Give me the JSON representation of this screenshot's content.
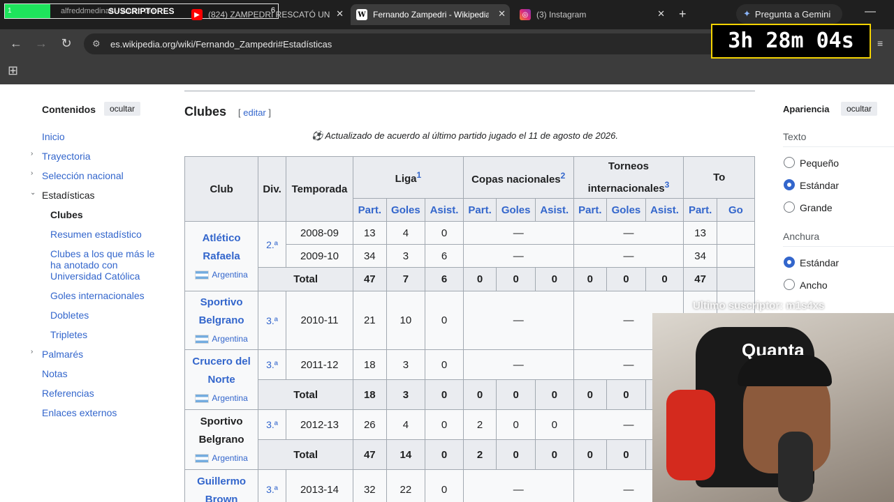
{
  "tabs": [
    {
      "title": "alfreddmedinaa - Watch the",
      "favicon": "stream"
    },
    {
      "title": "(824) ZAMPEDRI RESCATÓ UN",
      "favicon": "youtube"
    },
    {
      "title": "Fernando Zampedri - Wikipedia",
      "favicon": "wikipedia"
    },
    {
      "title": "(3) Instagram",
      "favicon": "instagram"
    }
  ],
  "subs_overlay": {
    "label": "SUSCRIPTORES",
    "left_num": "1",
    "right_num": "6"
  },
  "gemini_label": "Pregunta a Gemini",
  "url": "es.wikipedia.org/wiki/Fernando_Zampedri#Estadísticas",
  "timer": "3h 28m 04s",
  "toc": {
    "title": "Contenidos",
    "hide": "ocultar",
    "items": [
      "Inicio",
      "Trayectoria",
      "Selección nacional",
      "Estadísticas",
      "Clubes",
      "Resumen estadístico",
      "Clubes a los que más le ha anotado con Universidad Católica",
      "Goles internacionales",
      "Dobletes",
      "Tripletes",
      "Palmarés",
      "Notas",
      "Referencias",
      "Enlaces externos"
    ]
  },
  "section": {
    "title": "Clubes",
    "edit": "editar",
    "note": "Actualizado de acuerdo al último partido jugado el 11 de agosto de 2026."
  },
  "table": {
    "headers": {
      "club": "Club",
      "div": "Div.",
      "season": "Temporada",
      "liga": "Liga",
      "liga_sup": "1",
      "copas": "Copas nacionales",
      "copas_sup": "2",
      "torneos": "Torneos internacionales",
      "torneos_sup": "3",
      "total": "To"
    },
    "sub": {
      "part": "Part.",
      "goles": "Goles",
      "asist": "Asist.",
      "go": "Go"
    },
    "country": "Argentina",
    "total_label": "Total",
    "dash": "—",
    "clubs": [
      {
        "name": "Atlético Rafaela",
        "div": "2.ª"
      },
      {
        "name": "Sportivo Belgrano",
        "div": "3.ª"
      },
      {
        "name": "Crucero del Norte",
        "div": "3.ª"
      },
      {
        "name": "Sportivo Belgrano",
        "div": "3.ª"
      },
      {
        "name": "Guillermo Brown",
        "div": "3.ª"
      }
    ],
    "rows": [
      {
        "season": "2008-09",
        "p": "13",
        "g": "4",
        "a": "0",
        "tp": "13"
      },
      {
        "season": "2009-10",
        "p": "34",
        "g": "3",
        "a": "6",
        "tp": "34"
      },
      {
        "season": "2010-11",
        "p": "21",
        "g": "10",
        "a": "0"
      },
      {
        "season": "2011-12",
        "p": "18",
        "g": "3",
        "a": "0"
      },
      {
        "season": "2012-13",
        "p": "26",
        "g": "4",
        "a": "0",
        "cp": "2",
        "cg": "0",
        "ca": "0"
      },
      {
        "season": "2013-14",
        "p": "32",
        "g": "22",
        "a": "0"
      }
    ],
    "totals": [
      {
        "p": "47",
        "g": "7",
        "a": "6",
        "cp": "0",
        "cg": "0",
        "ca": "0",
        "ip": "0",
        "ig": "0",
        "ia": "0",
        "tp": "47"
      },
      {
        "p": "18",
        "g": "3",
        "a": "0",
        "cp": "0",
        "cg": "0",
        "ca": "0",
        "ip": "0",
        "ig": "0"
      },
      {
        "p": "47",
        "g": "14",
        "a": "0",
        "cp": "2",
        "cg": "0",
        "ca": "0",
        "ip": "0",
        "ig": "0"
      }
    ]
  },
  "appearance": {
    "title": "Apariencia",
    "hide": "ocultar",
    "text_label": "Texto",
    "text_options": [
      "Pequeño",
      "Estándar",
      "Grande"
    ],
    "width_label": "Anchura",
    "width_options": [
      "Estándar",
      "Ancho"
    ]
  },
  "webcam": {
    "last_sub": "Ultimo suscriptor: m1s4xs",
    "brand": "Quanta"
  }
}
